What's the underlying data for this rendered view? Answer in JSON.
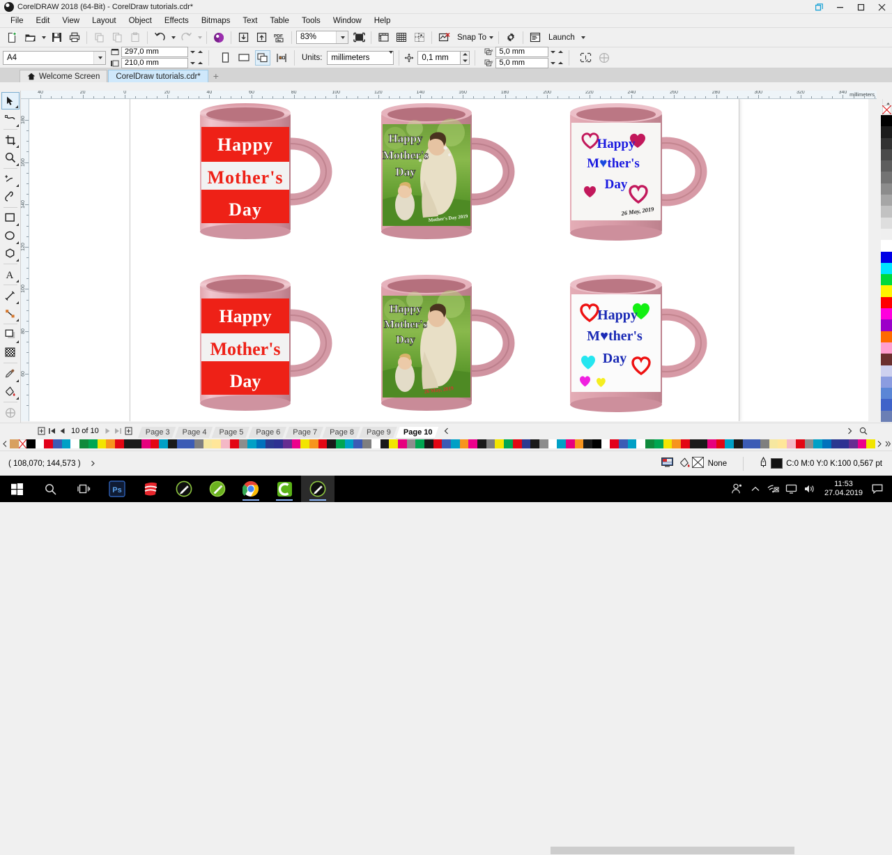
{
  "titlebar": {
    "title": "CorelDRAW 2018 (64-Bit) - CorelDraw  tutorials.cdr*",
    "restore_label": "restore-down",
    "minimize_label": "minimize",
    "maximize_label": "maximize",
    "close_label": "close"
  },
  "menubar": {
    "items": [
      {
        "label": "File"
      },
      {
        "label": "Edit"
      },
      {
        "label": "View"
      },
      {
        "label": "Layout"
      },
      {
        "label": "Object"
      },
      {
        "label": "Effects"
      },
      {
        "label": "Bitmaps"
      },
      {
        "label": "Text"
      },
      {
        "label": "Table"
      },
      {
        "label": "Tools"
      },
      {
        "label": "Window"
      },
      {
        "label": "Help"
      }
    ]
  },
  "standard_toolbar": {
    "new_doc": "new-document-icon",
    "open": "open-folder-icon",
    "save": "save-floppy-icon",
    "print": "print-icon",
    "cut": "cut-icon",
    "copy": "copy-icon",
    "paste": "paste-icon",
    "undo": "undo-icon",
    "redo": "redo-icon",
    "search_content": "corel-connect-icon",
    "import": "import-icon",
    "export": "export-icon",
    "export_pdf": "export-pdf-icon",
    "zoom_level": "83%",
    "full_screen": "full-screen-preview-icon",
    "show_rulers": "show-rulers-icon",
    "show_grid": "show-grid-icon",
    "show_guides": "show-guides-icon",
    "snap_off": "snap-off-icon",
    "snap_to_label": "Snap To",
    "options": "options-gear-icon",
    "launch_label": "Launch"
  },
  "property_bar": {
    "page_size": "A4",
    "page_width": "297,0 mm",
    "page_height": "210,0 mm",
    "portrait": "portrait-icon",
    "landscape": "landscape-icon",
    "all_pages": "all-pages-icon",
    "current_page": "current-page-only-icon",
    "units_label": "Units:",
    "units_value": "millimeters",
    "nudge_icon": "nudge-offset-icon",
    "nudge_value": "0,1 mm",
    "duplicate_x_label": "x",
    "duplicate_x": "5,0 mm",
    "duplicate_y_label": "y",
    "duplicate_y": "5,0 mm",
    "treat_as_filled": "treat-as-filled-icon",
    "wireframe": "wireframe-icon"
  },
  "document_tabs": {
    "home_icon": "home-icon",
    "tabs": [
      {
        "label": "Welcome Screen",
        "active": false,
        "has_home": true
      },
      {
        "label": "CorelDraw  tutorials.cdr*",
        "active": true,
        "has_home": false
      }
    ],
    "add_label": "+"
  },
  "rulers": {
    "horizontal_labels": [
      "40",
      "20",
      "0",
      "20",
      "40",
      "60",
      "80",
      "100",
      "120",
      "140",
      "160",
      "180",
      "200",
      "220",
      "240",
      "260",
      "280",
      "300",
      "320",
      "340"
    ],
    "horizontal_unit": "millimeters",
    "vertical_labels": [
      "180",
      "160",
      "140",
      "120",
      "100",
      "80",
      "60"
    ]
  },
  "toolbox": {
    "tools": [
      {
        "name": "pick-tool",
        "selected": true,
        "flyout": true
      },
      {
        "name": "shape-tool",
        "selected": false,
        "flyout": true
      },
      {
        "name": "crop-tool",
        "selected": false,
        "flyout": true
      },
      {
        "name": "zoom-tool",
        "selected": false,
        "flyout": true
      },
      {
        "name": "freehand-tool",
        "selected": false,
        "flyout": true
      },
      {
        "name": "artistic-media-tool",
        "selected": false,
        "flyout": false
      },
      {
        "name": "rectangle-tool",
        "selected": false,
        "flyout": true
      },
      {
        "name": "ellipse-tool",
        "selected": false,
        "flyout": true
      },
      {
        "name": "polygon-tool",
        "selected": false,
        "flyout": true
      },
      {
        "name": "text-tool",
        "selected": false,
        "flyout": true
      },
      {
        "name": "parallel-dimension-tool",
        "selected": false,
        "flyout": true
      },
      {
        "name": "straight-line-connector-tool",
        "selected": false,
        "flyout": true
      },
      {
        "name": "drop-shadow-tool",
        "selected": false,
        "flyout": true
      },
      {
        "name": "transparency-tool",
        "selected": false,
        "flyout": false
      },
      {
        "name": "color-eyedropper-tool",
        "selected": false,
        "flyout": true
      },
      {
        "name": "interactive-fill-tool",
        "selected": false,
        "flyout": true
      },
      {
        "name": "smart-fill-tool",
        "selected": false,
        "flyout": false
      }
    ]
  },
  "canvas": {
    "mugs": [
      {
        "id": "mug-red-1",
        "design": "red-banner",
        "lines": [
          "Happy",
          "Mother's",
          "Day"
        ]
      },
      {
        "id": "mug-photo-1",
        "design": "photo",
        "lines": [
          "Happy",
          "Mother's",
          "Day"
        ],
        "watermark": "Mother's Day 2019"
      },
      {
        "id": "mug-hearts-1",
        "design": "hearts-pink",
        "lines": [
          "Happy",
          "M♥ther's",
          "Day"
        ],
        "date": "26 May, 2019"
      },
      {
        "id": "mug-red-2",
        "design": "red-banner",
        "lines": [
          "Happy",
          "Mother's",
          "Day"
        ]
      },
      {
        "id": "mug-photo-2",
        "design": "photo",
        "lines": [
          "Happy",
          "Mother's",
          "Day"
        ],
        "watermark": "26 May, 2019"
      },
      {
        "id": "mug-hearts-2",
        "design": "hearts-color",
        "lines": [
          "Happy",
          "M♥ther's",
          "Day"
        ]
      }
    ]
  },
  "page_nav": {
    "add_page_start": "add-page-icon",
    "first": "first-page-icon",
    "prev": "previous-page-icon",
    "counter": "10 of 10",
    "next": "next-page-icon",
    "last": "last-page-icon",
    "add_page_end": "add-page-icon",
    "tabs": [
      {
        "label": "Page 3",
        "active": false
      },
      {
        "label": "Page 4",
        "active": false
      },
      {
        "label": "Page 5",
        "active": false
      },
      {
        "label": "Page 6",
        "active": false
      },
      {
        "label": "Page 7",
        "active": false
      },
      {
        "label": "Page 8",
        "active": false
      },
      {
        "label": "Page 9",
        "active": false
      },
      {
        "label": "Page 10",
        "active": true
      }
    ],
    "scroll_left": "scroll-left-icon"
  },
  "status_bar": {
    "coordinates": "( 108,070; 144,573 )",
    "expand_icon": "expand-status-icon",
    "color_proof_icon": "color-proof-icon",
    "fill_icon": "fill-icon",
    "fill_value": "None",
    "outline_icon": "outline-pen-icon",
    "outline_value": "C:0 M:0 Y:0 K:100  0,567 pt"
  },
  "color_palette": {
    "no_color": "none-swatch-x",
    "horizontal": [
      "#000000",
      "#ffffff",
      "#e2001a",
      "#3b5bb5",
      "#00a0c6",
      "#ffffff",
      "#0f8a3c",
      "#00a651",
      "#f2e500",
      "#f7941d",
      "#e30613",
      "#1a1a1a",
      "#1a1a1a",
      "#e6007e",
      "#e30613",
      "#00a0c6",
      "#1a1a1a",
      "#3b5bb5",
      "#3b5bb5",
      "#7f7f7f",
      "#f6e7a0",
      "#ffe699",
      "#f4b8c6",
      "#e30613",
      "#8d8d8d",
      "#00a0c6",
      "#0071bc",
      "#2b3990",
      "#2e3192",
      "#662d91",
      "#ec008c",
      "#f2e500",
      "#f7941d",
      "#e30613",
      "#1a1a1a",
      "#00a651",
      "#00a0c6",
      "#3b5bb5",
      "#7f7f7f",
      "#ffffff",
      "#1a1a1a",
      "#f2e500",
      "#e6007e",
      "#8d8d8d",
      "#00a651",
      "#1a1a1a",
      "#e30613",
      "#3b5bb5",
      "#00a0c6",
      "#f7941d",
      "#ec008c",
      "#1a1a1a",
      "#7f7f7f",
      "#f2e500",
      "#00a651",
      "#e30613",
      "#2b3990",
      "#1a1a1a",
      "#8d8d8d",
      "#ffffff",
      "#00a0c6",
      "#e6007e",
      "#f7941d",
      "#1a1a1a"
    ],
    "vertical": [
      "#000000",
      "#1c1c1c",
      "#333333",
      "#4a4a4a",
      "#5e5e5e",
      "#737373",
      "#8c8c8c",
      "#a6a6a6",
      "#c2c2c2",
      "#dedede",
      "#efefef",
      "#ffffff",
      "#0000e6",
      "#00e5ff",
      "#00d93c",
      "#fff200",
      "#ff0000",
      "#ff00dd",
      "#9c00c9",
      "#ff6a00",
      "#ff9ecf",
      "#6b2f2f",
      "#cdd0ef",
      "#8b9ce0",
      "#5b86d6",
      "#3f63c9",
      "#6b7fb5"
    ]
  },
  "taskbar": {
    "start": "windows-start-icon",
    "search": "search-icon",
    "task_view": "task-view-icon",
    "apps": [
      {
        "name": "photoshop-icon",
        "label": "Ps",
        "active": false,
        "running": false
      },
      {
        "name": "sketchup-icon",
        "label": "",
        "active": false,
        "running": false
      },
      {
        "name": "coreldraw-icon",
        "label": "",
        "active": false,
        "running": false
      },
      {
        "name": "corel-photo-paint-icon",
        "label": "",
        "active": false,
        "running": false
      },
      {
        "name": "chrome-icon",
        "label": "",
        "active": false,
        "running": true
      },
      {
        "name": "camtasia-icon",
        "label": "",
        "active": false,
        "running": true
      },
      {
        "name": "coreldraw-active-icon",
        "label": "",
        "active": true,
        "running": true
      }
    ],
    "tray": {
      "people": "people-icon",
      "chevron": "show-hidden-icons-icon",
      "network_blocked": "network-blocked-icon",
      "display": "display-icon",
      "volume": "volume-icon",
      "time": "11:53",
      "date": "27.04.2019",
      "action_center": "action-center-icon"
    }
  }
}
